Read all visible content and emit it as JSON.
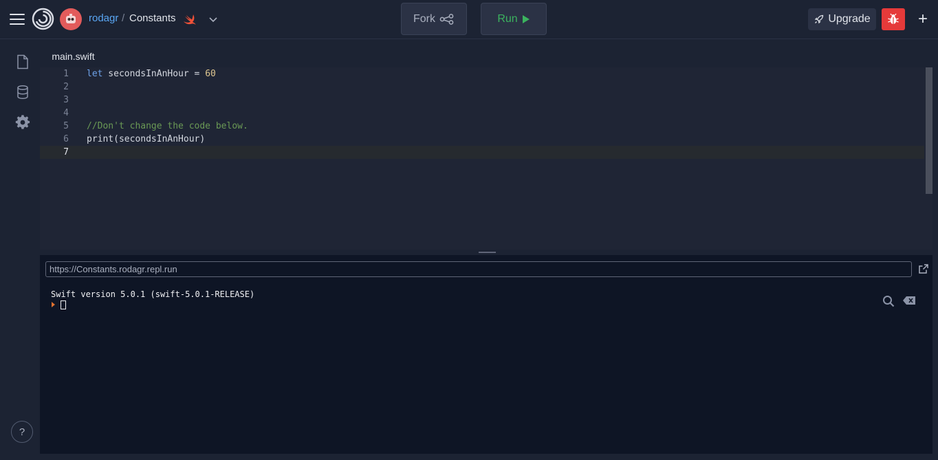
{
  "header": {
    "username": "rodagr",
    "separator": "/",
    "project_name": "Constants",
    "fork_label": "Fork",
    "run_label": "Run",
    "upgrade_label": "Upgrade",
    "plus_label": "+"
  },
  "sidebar": {
    "items": [
      {
        "icon": "file-icon"
      },
      {
        "icon": "database-icon"
      },
      {
        "icon": "gear-icon"
      }
    ],
    "help_label": "?"
  },
  "editor": {
    "tab_label": "main.swift",
    "lines": [
      {
        "number": "1",
        "text": "let secondsInAnHour = 60"
      },
      {
        "number": "2",
        "text": ""
      },
      {
        "number": "3",
        "text": ""
      },
      {
        "number": "4",
        "text": ""
      },
      {
        "number": "5",
        "text": "//Don't change the code below."
      },
      {
        "number": "6",
        "text": "print(secondsInAnHour)"
      },
      {
        "number": "7",
        "text": ""
      }
    ],
    "line1_keyword": "let",
    "line1_ident": " secondsInAnHour = ",
    "line1_number": "60"
  },
  "console": {
    "url_value": "https://Constants.rodagr.repl.run",
    "output": "Swift version 5.0.1 (swift-5.0.1-RELEASE)"
  },
  "colors": {
    "accent_blue": "#5aa7f5",
    "run_green": "#3bb35e",
    "bug_red": "#e53a3a",
    "comment_green": "#6a9955"
  }
}
